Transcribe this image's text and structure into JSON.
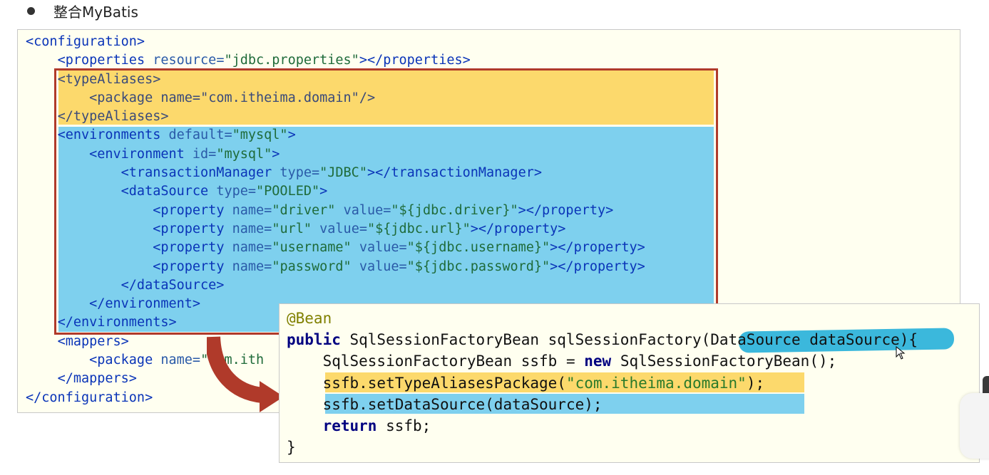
{
  "heading": {
    "bullet": "●",
    "title": "整合MyBatis"
  },
  "xml": {
    "l1": "<configuration>",
    "l2_tag": "<properties ",
    "l2_attr": "resource=",
    "l2_val": "\"jdbc.properties\"",
    "l2_end": "></properties>",
    "l3": "<typeAliases>",
    "l4_tag": "<package ",
    "l4_attr": "name=",
    "l4_val": "\"com.itheima.domain\"",
    "l4_end": "/>",
    "l5": "</typeAliases>",
    "l6_tag": "<environments ",
    "l6_attr": "default=",
    "l6_val": "\"mysql\"",
    "l6_end": ">",
    "l7_tag": "<environment ",
    "l7_attr": "id=",
    "l7_val": "\"mysql\"",
    "l7_end": ">",
    "l8_tag": "<transactionManager ",
    "l8_attr": "type=",
    "l8_val": "\"JDBC\"",
    "l8_end": "></transactionManager>",
    "l9_tag": "<dataSource ",
    "l9_attr": "type=",
    "l9_val": "\"POOLED\"",
    "l9_end": ">",
    "p1_tag": "<property ",
    "p1_a1": "name=",
    "p1_v1": "\"driver\" ",
    "p1_a2": "value=",
    "p1_v2": "\"${jdbc.driver}\"",
    "p1_end": "></property>",
    "p2_tag": "<property ",
    "p2_a1": "name=",
    "p2_v1": "\"url\" ",
    "p2_a2": "value=",
    "p2_v2": "\"${jdbc.url}\"",
    "p2_end": "></property>",
    "p3_tag": "<property ",
    "p3_a1": "name=",
    "p3_v1": "\"username\" ",
    "p3_a2": "value=",
    "p3_v2": "\"${jdbc.username}\"",
    "p3_end": "></property>",
    "p4_tag": "<property ",
    "p4_a1": "name=",
    "p4_v1": "\"password\" ",
    "p4_a2": "value=",
    "p4_v2": "\"${jdbc.password}\"",
    "p4_end": "></property>",
    "l14": "</dataSource>",
    "l15": "</environment>",
    "l16": "</environments>",
    "l17": "<mappers>",
    "l18_tag": "<package ",
    "l18_attr": "name=",
    "l18_val": "\"com.ith",
    "l19": "</mappers>",
    "l20": "</configuration>"
  },
  "java": {
    "anno": "@Bean",
    "l2_kw": "public",
    "l2_rest": " SqlSessionFactoryBean sqlSessionFactory(DataSource dataSource){",
    "l3_a": "SqlSessionFactoryBean ssfb = ",
    "l3_kw": "new",
    "l3_b": " SqlSessionFactoryBean();",
    "l4_a": "ssfb.setTypeAliasesPackage(",
    "l4_str": "\"com.itheima.domain\"",
    "l4_b": ");",
    "l5": "ssfb.setDataSource(dataSource);",
    "l6_kw": "return",
    "l6_b": " ssfb;",
    "l7": "}"
  },
  "colors": {
    "highlight_yellow": "#fcd96c",
    "highlight_blue": "#7ed0ee",
    "frame_red": "#b03a2a",
    "marker": "#3bb8dc"
  }
}
